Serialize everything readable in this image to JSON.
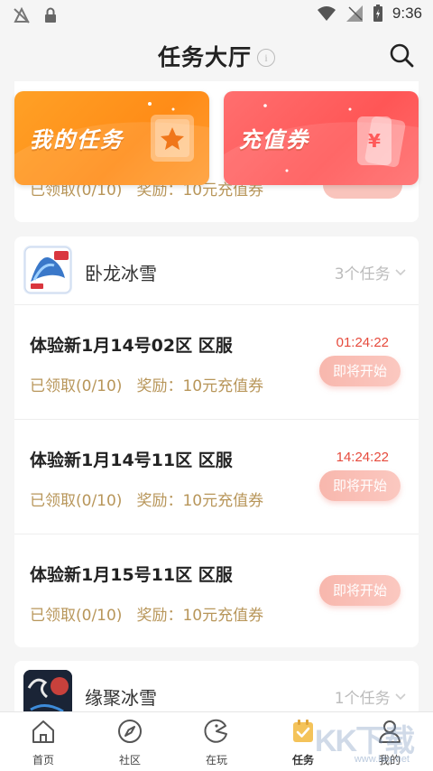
{
  "status_bar": {
    "time": "9:36"
  },
  "header": {
    "title": "任务大厅",
    "info_symbol": "i"
  },
  "banners": {
    "my_tasks": "我的任务",
    "recharge": "充值券"
  },
  "top_partial": {
    "claimed": "已领取(0/10)",
    "reward": "奖励：10元充值券"
  },
  "games": [
    {
      "name": "卧龙冰雪",
      "count": "3个任务",
      "tasks": [
        {
          "title": "体验新1月14号02区 区服",
          "claimed": "已领取(0/10)",
          "reward": "奖励：10元充值券",
          "time": "01:24:22",
          "button": "即将开始"
        },
        {
          "title": "体验新1月14号11区 区服",
          "claimed": "已领取(0/10)",
          "reward": "奖励：10元充值券",
          "time": "14:24:22",
          "button": "即将开始"
        },
        {
          "title": "体验新1月15号11区 区服",
          "claimed": "已领取(0/10)",
          "reward": "奖励：10元充值券",
          "time": "",
          "button": "即将开始"
        }
      ]
    },
    {
      "name": "缘聚冰雪",
      "count": "1个任务"
    }
  ],
  "tabbar": {
    "items": [
      {
        "label": "首页",
        "icon": "home-icon"
      },
      {
        "label": "社区",
        "icon": "compass-icon"
      },
      {
        "label": "在玩",
        "icon": "pacman-icon"
      },
      {
        "label": "任务",
        "icon": "task-icon"
      },
      {
        "label": "我的",
        "icon": "user-icon"
      }
    ]
  },
  "watermark": {
    "logo": "KK下载",
    "url": "www.kkx.net"
  },
  "colors": {
    "orange": "#ff9a24",
    "red": "#ff5f5f",
    "gold": "#b8965a",
    "timer": "#e64a3c"
  }
}
